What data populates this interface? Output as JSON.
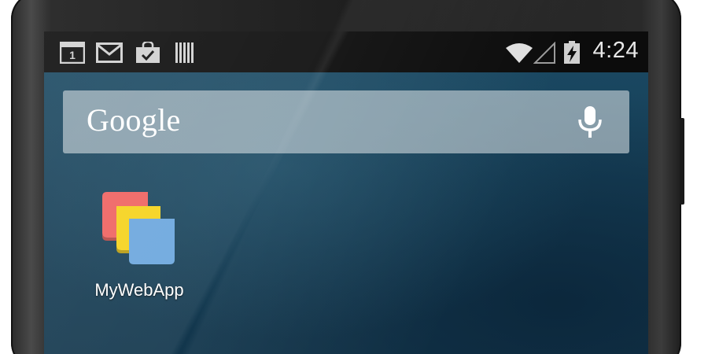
{
  "status_bar": {
    "clock": "4:24",
    "calendar_day": "1",
    "icons": [
      "calendar-icon",
      "gmail-icon",
      "play-store-icon",
      "barcode-icon",
      "wifi-icon",
      "signal-icon",
      "battery-charging-icon"
    ]
  },
  "search": {
    "logo_text": "Google",
    "mic_icon": "mic-icon"
  },
  "home": {
    "apps": [
      {
        "label": "MyWebApp",
        "icon": "mywebapp-icon"
      }
    ]
  },
  "colors": {
    "status_bar": "#0c0c0c",
    "wallpaper": "#163f57",
    "app_icon_red": "#ef6260",
    "app_icon_yellow": "#f5d21b",
    "app_icon_blue": "#6ba6dd"
  }
}
